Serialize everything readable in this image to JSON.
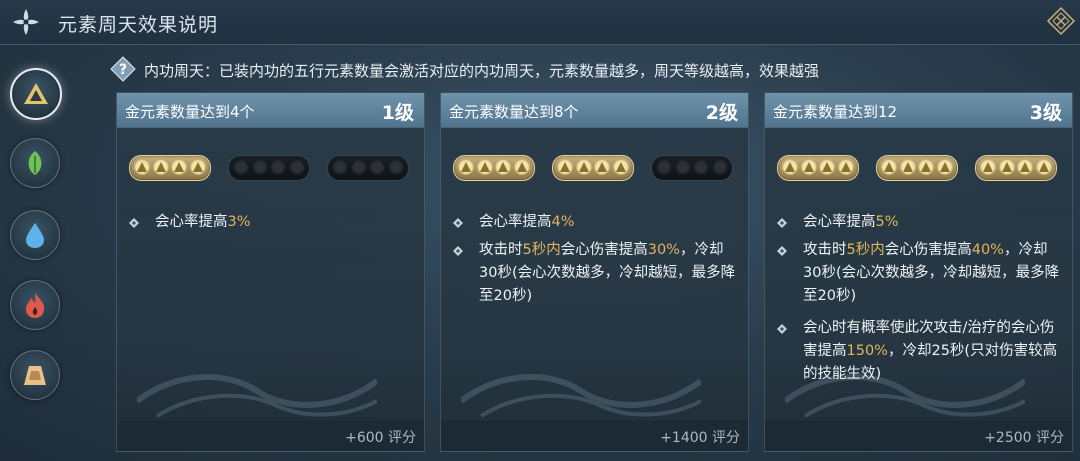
{
  "header": {
    "title": "元素周天效果说明"
  },
  "info": {
    "text": "内功周天：已装内功的五行元素数量会激活对应的内功周天，元素数量越多，周天等级越高，效果越强"
  },
  "sidebar": {
    "items": [
      {
        "element": "metal",
        "icon": "metal-triangle-icon",
        "active": true
      },
      {
        "element": "wood",
        "icon": "leaf-icon",
        "active": false
      },
      {
        "element": "water",
        "icon": "water-drop-icon",
        "active": false
      },
      {
        "element": "fire",
        "icon": "flame-icon",
        "active": false
      },
      {
        "element": "earth",
        "icon": "mountain-icon",
        "active": false
      }
    ]
  },
  "cards": [
    {
      "title": "金元素数量达到4个",
      "level": "1级",
      "pip_groups_active": 1,
      "effects": [
        {
          "parts": [
            {
              "t": "会心率提高"
            },
            {
              "t": "3%",
              "hl": true
            }
          ]
        }
      ],
      "score": "+600 评分"
    },
    {
      "title": "金元素数量达到8个",
      "level": "2级",
      "pip_groups_active": 2,
      "effects": [
        {
          "parts": [
            {
              "t": "会心率提高"
            },
            {
              "t": "4%",
              "hl": true
            }
          ]
        },
        {
          "parts": [
            {
              "t": "攻击时"
            },
            {
              "t": "5秒内",
              "hl": true
            },
            {
              "t": "会心伤害提高"
            },
            {
              "t": "30%",
              "hl": true
            },
            {
              "t": "，冷却30秒(会心次数越多，冷却越短，最多降至20秒)"
            }
          ]
        }
      ],
      "score": "+1400 评分"
    },
    {
      "title": "金元素数量达到12",
      "level": "3级",
      "pip_groups_active": 3,
      "effects": [
        {
          "parts": [
            {
              "t": "会心率提高"
            },
            {
              "t": "5%",
              "hl": true
            }
          ]
        },
        {
          "parts": [
            {
              "t": "攻击时"
            },
            {
              "t": "5秒内",
              "hl": true
            },
            {
              "t": "会心伤害提高"
            },
            {
              "t": "40%",
              "hl": true
            },
            {
              "t": "，冷却30秒(会心次数越多，冷却越短，最多降至20秒)"
            }
          ]
        },
        {
          "parts": [
            {
              "t": "会心时有概率使此次攻击/治疗的会心伤害提高"
            },
            {
              "t": "150%",
              "hl": true
            },
            {
              "t": "，冷却25秒(只对伤害较高的技能生效)"
            }
          ]
        }
      ],
      "score": "+2500 评分"
    }
  ],
  "colors": {
    "highlight": "#e2b45c",
    "header_bar": "#5f84a0",
    "pip_on": "#c7b07a"
  }
}
